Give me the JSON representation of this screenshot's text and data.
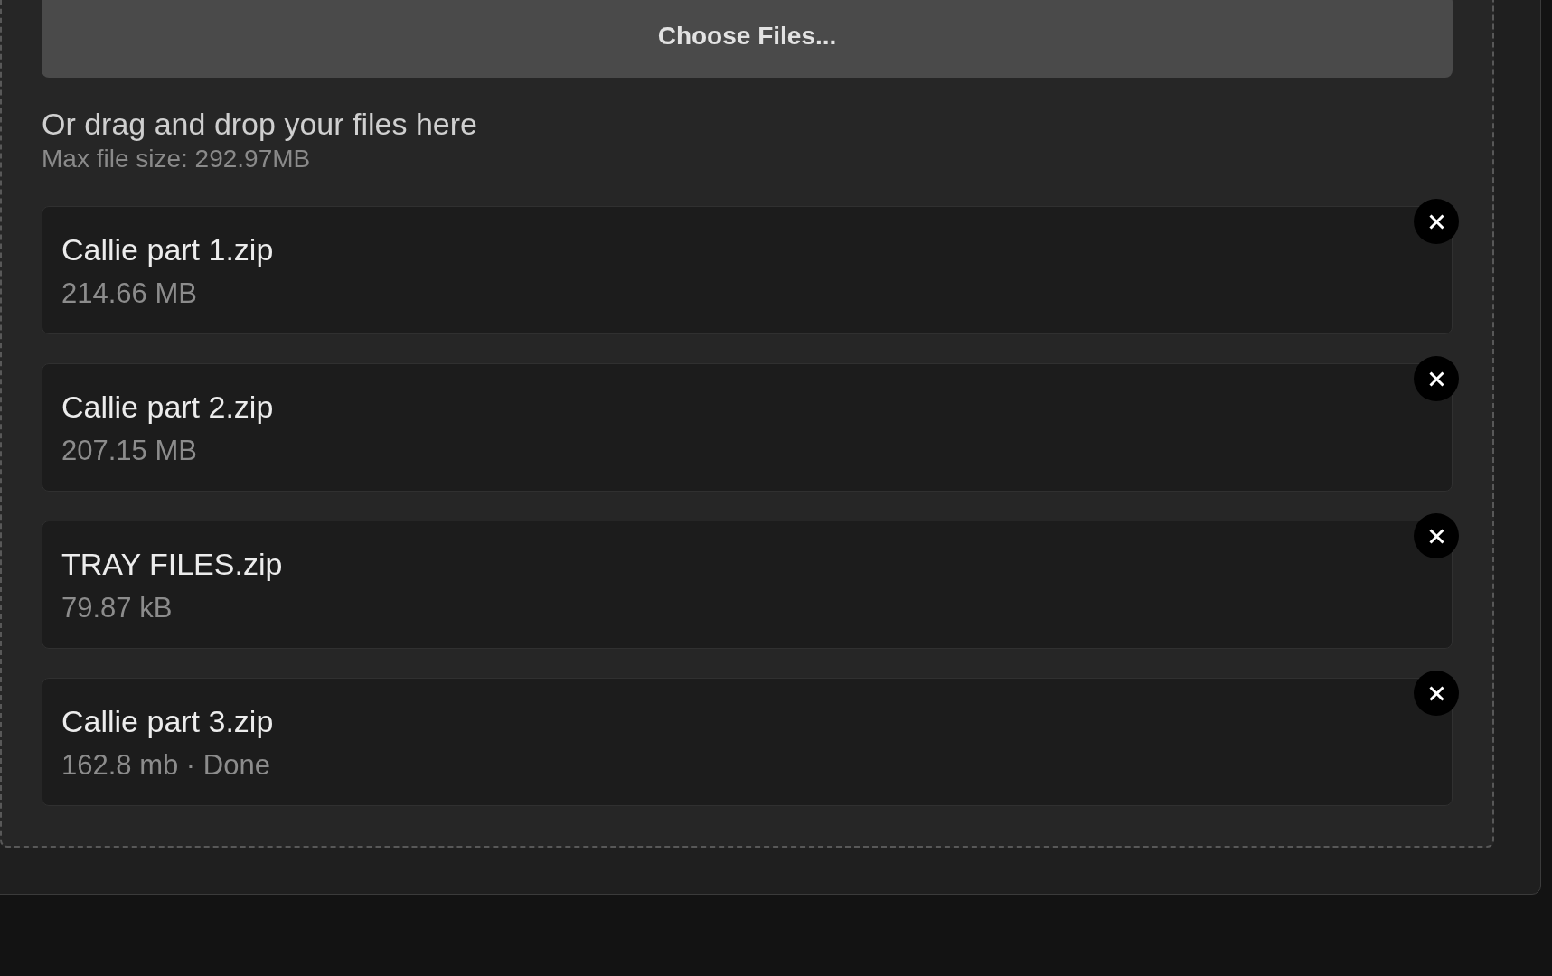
{
  "upload": {
    "choose_button": "Choose Files...",
    "hint": "Or drag and drop your files here",
    "max_size": "Max file size: 292.97MB"
  },
  "files": [
    {
      "name": "Callie part 1.zip",
      "details": "214.66 MB"
    },
    {
      "name": "Callie part 2.zip",
      "details": "207.15 MB"
    },
    {
      "name": "TRAY FILES.zip",
      "details": "79.87 kB"
    },
    {
      "name": "Callie part 3.zip",
      "details": "162.8 mb · Done"
    }
  ]
}
